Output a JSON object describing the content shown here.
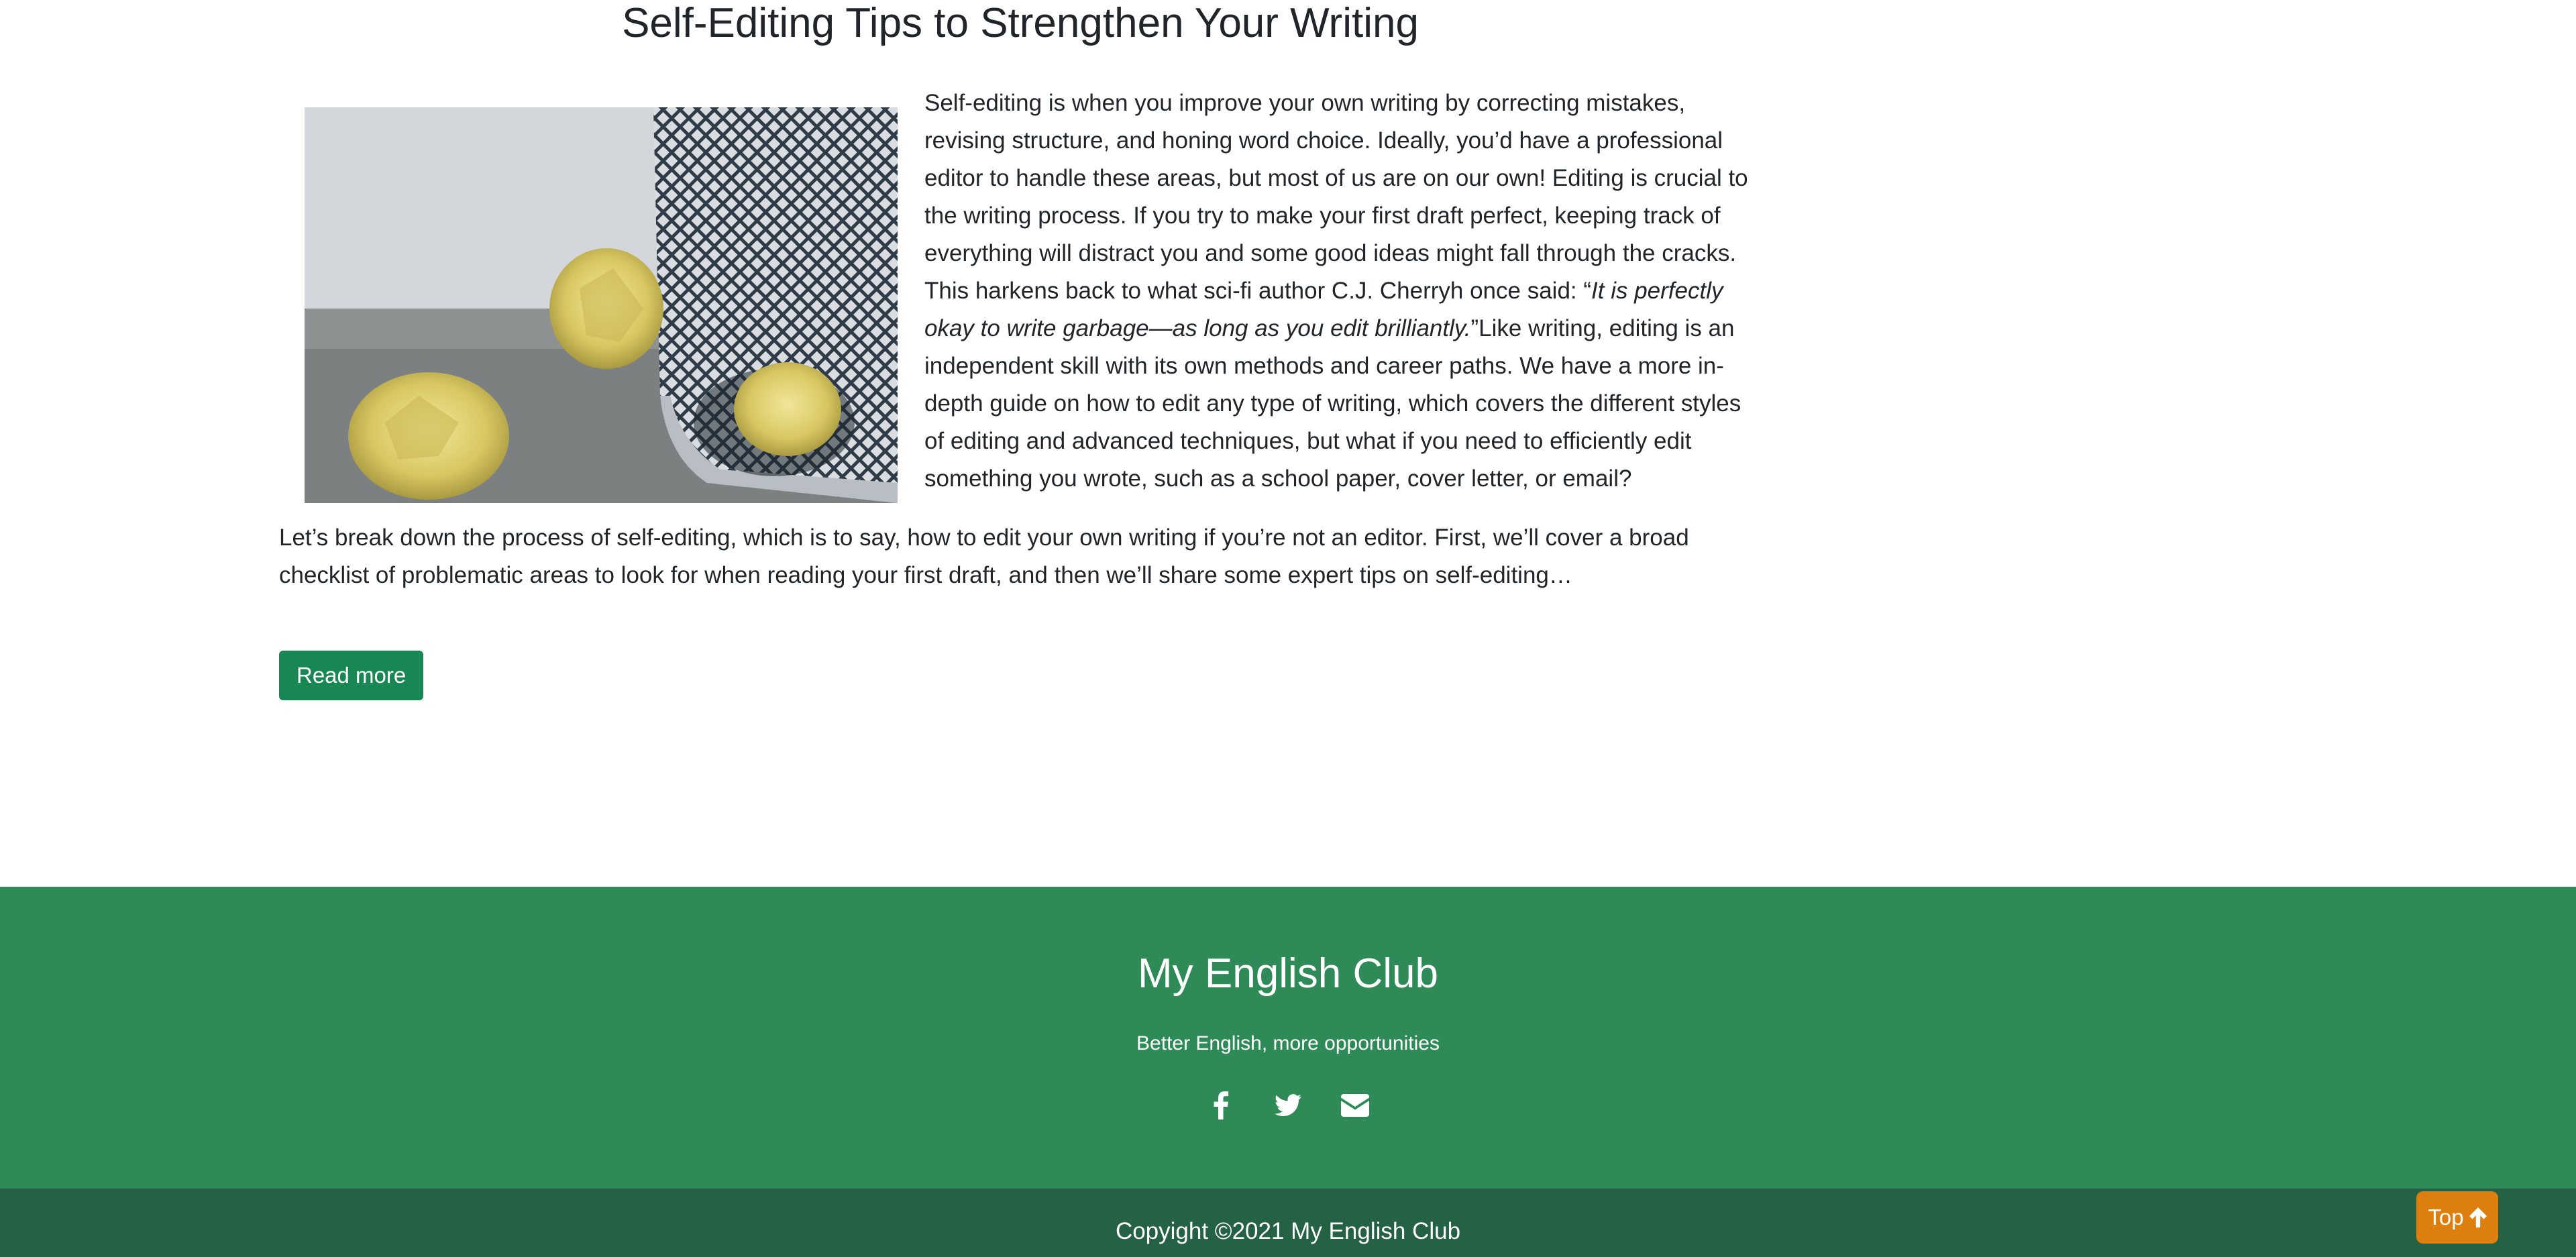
{
  "article": {
    "title": "Self-Editing Tips to Strengthen Your Writing",
    "paragraph1_part1": "Self-editing is when you improve your own writing by correcting mistakes, revising structure, and honing word choice. Ideally, you’d have a professional editor to handle these areas, but most of us are on our own! Editing is crucial to the writing process. If you try to make your first draft perfect, keeping track of everything will distract you and some good ideas might fall through the cracks. This harkens back to what sci-fi author C.J. Cherryh once said: “",
    "quote": "It is perfectly okay to write garbage—as long as you edit brilliantly.",
    "paragraph1_part2": "”Like writing, editing is an independent skill with its own methods and career paths. We have a more in-depth guide on how to edit any type of writing, which covers the different styles of editing and advanced techniques, but what if you need to efficiently edit something you wrote, such as a school paper, cover letter, or email?",
    "paragraph2": "Let’s break down the process of self-editing, which is to say, how to edit your own writing if you’re not an editor. First, we’ll cover a broad checklist of problematic areas to look for when reading your first draft, and then we’ll share some expert tips on self-editing…",
    "read_more_label": "Read more",
    "image_icon": "crumpled-paper-wastebasket-image"
  },
  "footer": {
    "title": "My English Club",
    "tagline": "Better English, more opportunities",
    "social_icons": [
      "facebook-icon",
      "twitter-icon",
      "envelope-icon"
    ],
    "background": "#2e8b57"
  },
  "copyright": {
    "text": "Copyight ©2021 My English Club",
    "background": "#256245"
  },
  "top_button": {
    "label": "Top",
    "icon": "arrow-up-icon",
    "background": "#dc7f0e"
  },
  "colors": {
    "accent_green": "#198754"
  }
}
